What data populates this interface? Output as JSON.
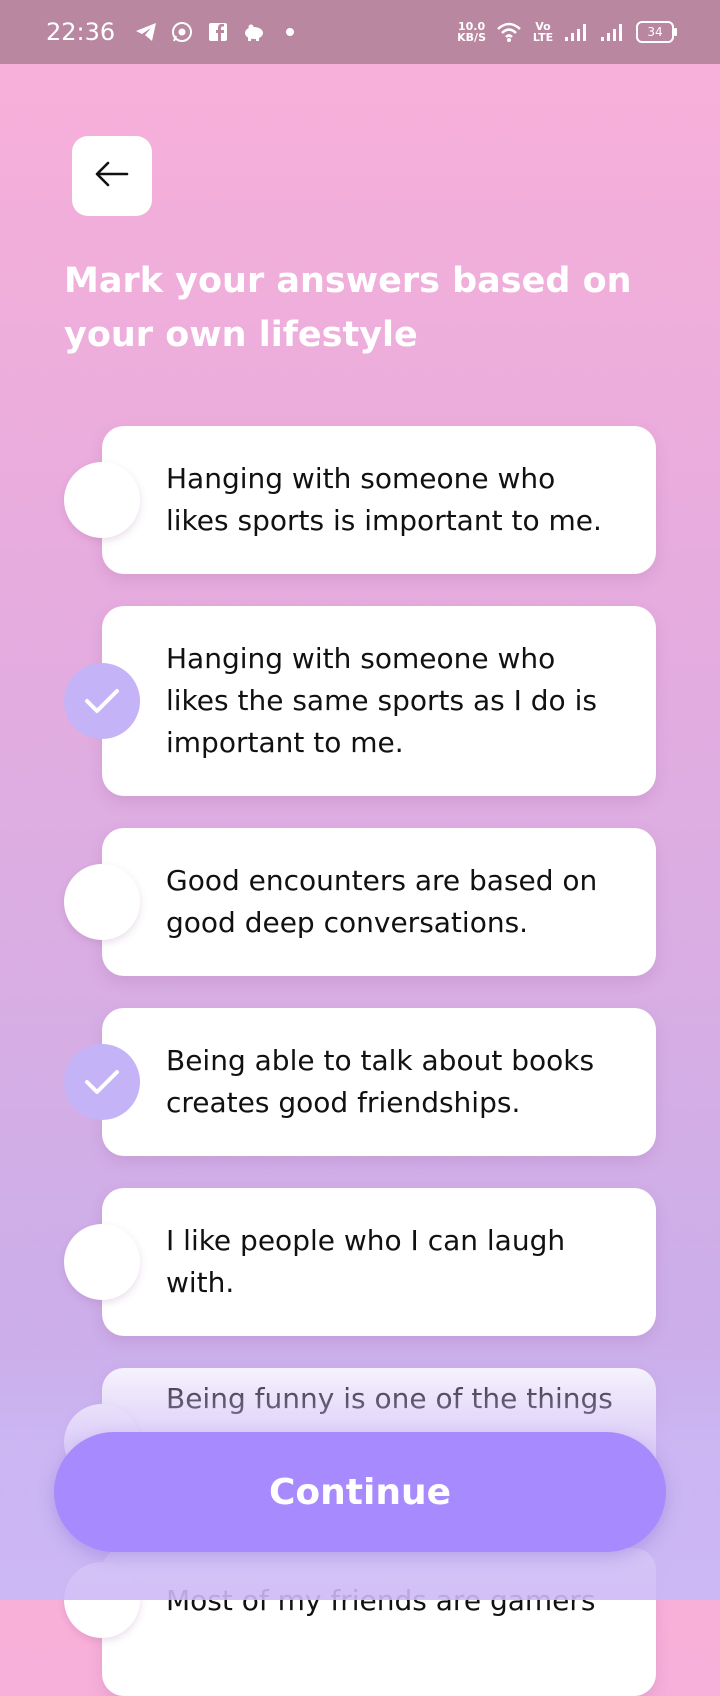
{
  "status_bar": {
    "time": "22:36",
    "net_speed_value": "10.0",
    "net_speed_unit": "KB/S",
    "volte_label": "Vo LTE",
    "battery": "34",
    "left_icons": [
      "telegram-icon",
      "whatsapp-icon",
      "facebook-icon",
      "piggy-bank-icon",
      "dot-icon"
    ],
    "right_icons": [
      "wifi-icon",
      "signal-icon",
      "signal-icon"
    ]
  },
  "header": {
    "back_icon": "arrow-left-icon",
    "title": "Mark your answers based on your own lifestyle"
  },
  "options": [
    {
      "text": "Hanging with someone who likes sports is important to me.",
      "checked": false
    },
    {
      "text": "Hanging with someone who likes the same sports as I do is important to me.",
      "checked": true
    },
    {
      "text": "Good encounters are based on good deep conversations.",
      "checked": false
    },
    {
      "text": "Being able to talk about books creates good friendships.",
      "checked": true
    },
    {
      "text": "I like people who I can laugh with.",
      "checked": false
    },
    {
      "text": "Being funny is one of the things",
      "checked": false
    },
    {
      "text": "Most of my friends are gamers",
      "checked": false
    }
  ],
  "footer": {
    "continue_label": "Continue"
  },
  "colors": {
    "accent": "#a88aff",
    "checked_circle": "#c4b3f6",
    "status_bar": "#b9879f"
  }
}
